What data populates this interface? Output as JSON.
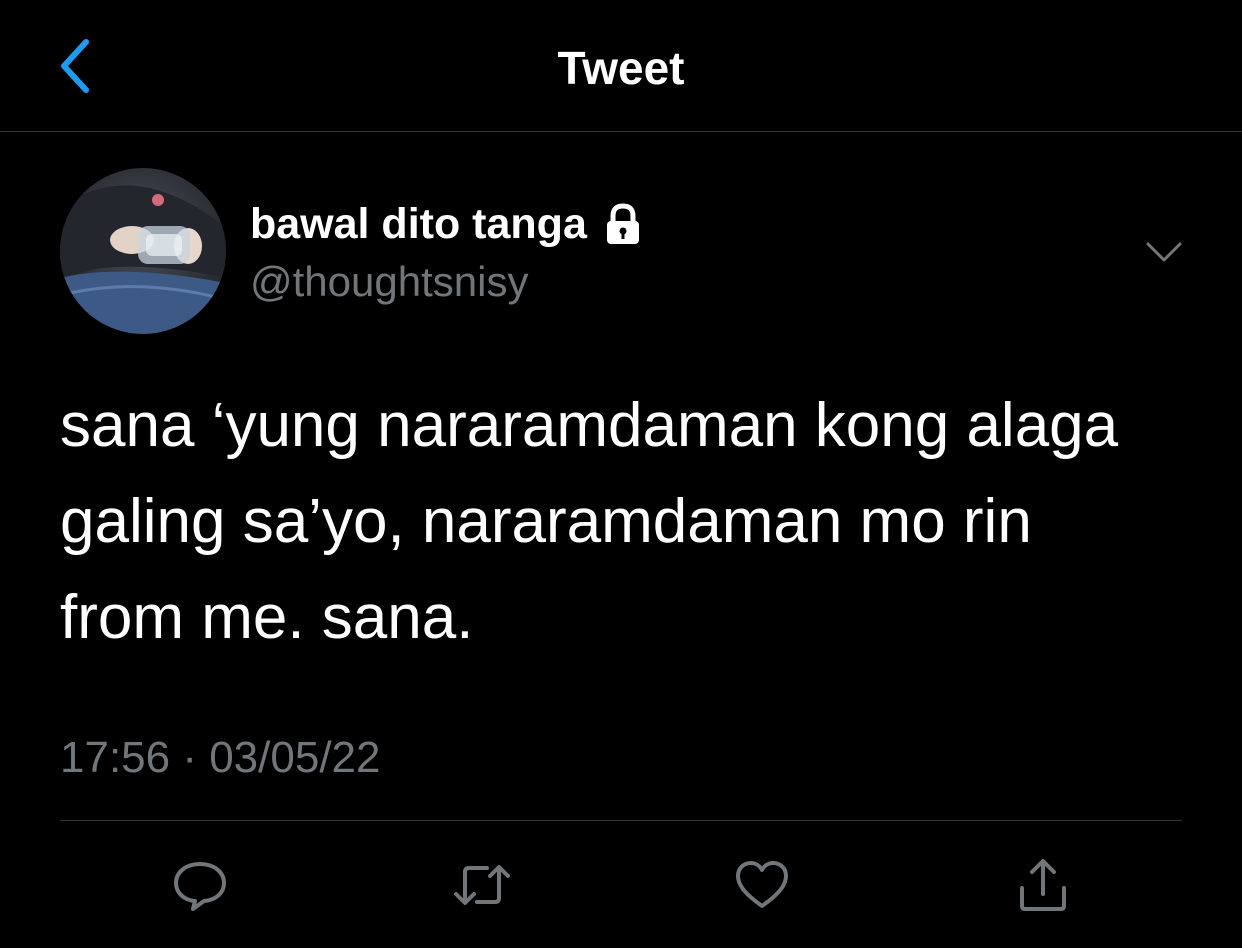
{
  "header": {
    "title": "Tweet",
    "back_icon": "chevron-left-icon",
    "accent_color": "#1d9bf0"
  },
  "author": {
    "display_name": "bawal dito tanga",
    "handle": "@thoughtsnisy",
    "protected_icon": "lock-icon",
    "avatar": "avatar-photo"
  },
  "tweet": {
    "lines": [
      "sana ‘yung nararamdaman kong alaga",
      "galing sa’yo, nararamdaman mo rin",
      "from me. sana."
    ],
    "timestamp": "17:56 · 03/05/22"
  },
  "actions": {
    "reply_icon": "reply-icon",
    "retweet_icon": "retweet-icon",
    "like_icon": "heart-icon",
    "share_icon": "share-icon",
    "icon_color": "#71767b"
  },
  "colors": {
    "background": "#000000",
    "text": "#ffffff",
    "secondary_text": "#71767b",
    "divider": "#2f3336"
  }
}
